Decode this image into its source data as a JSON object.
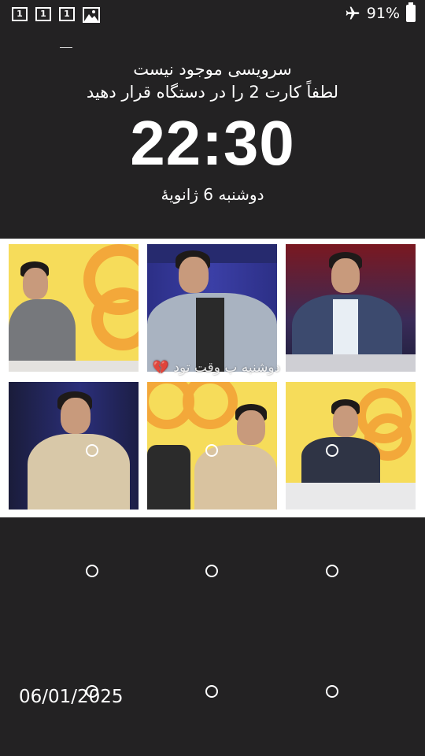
{
  "status_bar": {
    "sim_slots": [
      "1",
      "1",
      "1"
    ],
    "battery_percent": "91%",
    "airplane_mode": true,
    "battery_level": 0.91
  },
  "lock_screen": {
    "service_line1": "سرویسی موجود نیست",
    "service_line2": "لطفاً کارت 2 را در دستگاه قرار دهید",
    "time": "22:30",
    "date": "دوشنبه 6 ژانویهٔ"
  },
  "wallpaper": {
    "overlay_text": "دوشنبه ب وقت تود 💔",
    "colors": {
      "yellow": "#f6dc5a",
      "ring": "#f3a83a",
      "studio_blue": "#2a2e78",
      "studio_red": "#8a1a22"
    }
  },
  "pattern_grid": {
    "rows": 3,
    "cols": 3
  },
  "footer": {
    "date": "06/01/2025"
  }
}
